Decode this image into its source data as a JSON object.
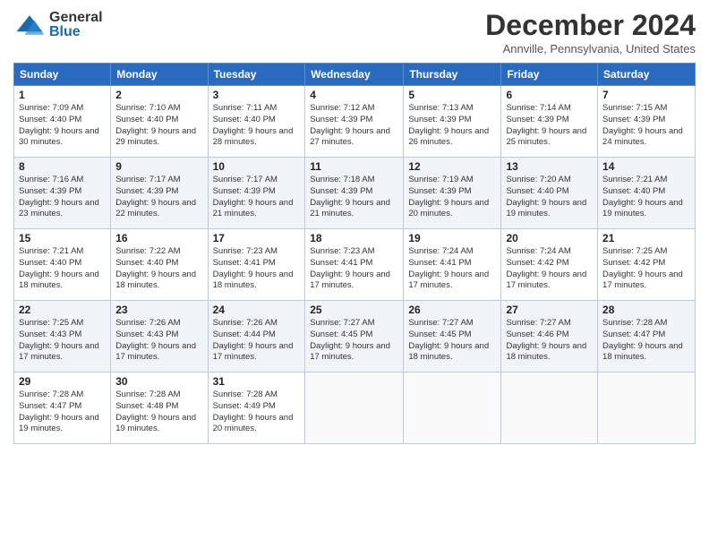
{
  "header": {
    "logo_general": "General",
    "logo_blue": "Blue",
    "month_title": "December 2024",
    "location": "Annville, Pennsylvania, United States"
  },
  "days_of_week": [
    "Sunday",
    "Monday",
    "Tuesday",
    "Wednesday",
    "Thursday",
    "Friday",
    "Saturday"
  ],
  "weeks": [
    [
      {
        "day": "1",
        "sunrise": "Sunrise: 7:09 AM",
        "sunset": "Sunset: 4:40 PM",
        "daylight": "Daylight: 9 hours and 30 minutes."
      },
      {
        "day": "2",
        "sunrise": "Sunrise: 7:10 AM",
        "sunset": "Sunset: 4:40 PM",
        "daylight": "Daylight: 9 hours and 29 minutes."
      },
      {
        "day": "3",
        "sunrise": "Sunrise: 7:11 AM",
        "sunset": "Sunset: 4:40 PM",
        "daylight": "Daylight: 9 hours and 28 minutes."
      },
      {
        "day": "4",
        "sunrise": "Sunrise: 7:12 AM",
        "sunset": "Sunset: 4:39 PM",
        "daylight": "Daylight: 9 hours and 27 minutes."
      },
      {
        "day": "5",
        "sunrise": "Sunrise: 7:13 AM",
        "sunset": "Sunset: 4:39 PM",
        "daylight": "Daylight: 9 hours and 26 minutes."
      },
      {
        "day": "6",
        "sunrise": "Sunrise: 7:14 AM",
        "sunset": "Sunset: 4:39 PM",
        "daylight": "Daylight: 9 hours and 25 minutes."
      },
      {
        "day": "7",
        "sunrise": "Sunrise: 7:15 AM",
        "sunset": "Sunset: 4:39 PM",
        "daylight": "Daylight: 9 hours and 24 minutes."
      }
    ],
    [
      {
        "day": "8",
        "sunrise": "Sunrise: 7:16 AM",
        "sunset": "Sunset: 4:39 PM",
        "daylight": "Daylight: 9 hours and 23 minutes."
      },
      {
        "day": "9",
        "sunrise": "Sunrise: 7:17 AM",
        "sunset": "Sunset: 4:39 PM",
        "daylight": "Daylight: 9 hours and 22 minutes."
      },
      {
        "day": "10",
        "sunrise": "Sunrise: 7:17 AM",
        "sunset": "Sunset: 4:39 PM",
        "daylight": "Daylight: 9 hours and 21 minutes."
      },
      {
        "day": "11",
        "sunrise": "Sunrise: 7:18 AM",
        "sunset": "Sunset: 4:39 PM",
        "daylight": "Daylight: 9 hours and 21 minutes."
      },
      {
        "day": "12",
        "sunrise": "Sunrise: 7:19 AM",
        "sunset": "Sunset: 4:39 PM",
        "daylight": "Daylight: 9 hours and 20 minutes."
      },
      {
        "day": "13",
        "sunrise": "Sunrise: 7:20 AM",
        "sunset": "Sunset: 4:40 PM",
        "daylight": "Daylight: 9 hours and 19 minutes."
      },
      {
        "day": "14",
        "sunrise": "Sunrise: 7:21 AM",
        "sunset": "Sunset: 4:40 PM",
        "daylight": "Daylight: 9 hours and 19 minutes."
      }
    ],
    [
      {
        "day": "15",
        "sunrise": "Sunrise: 7:21 AM",
        "sunset": "Sunset: 4:40 PM",
        "daylight": "Daylight: 9 hours and 18 minutes."
      },
      {
        "day": "16",
        "sunrise": "Sunrise: 7:22 AM",
        "sunset": "Sunset: 4:40 PM",
        "daylight": "Daylight: 9 hours and 18 minutes."
      },
      {
        "day": "17",
        "sunrise": "Sunrise: 7:23 AM",
        "sunset": "Sunset: 4:41 PM",
        "daylight": "Daylight: 9 hours and 18 minutes."
      },
      {
        "day": "18",
        "sunrise": "Sunrise: 7:23 AM",
        "sunset": "Sunset: 4:41 PM",
        "daylight": "Daylight: 9 hours and 17 minutes."
      },
      {
        "day": "19",
        "sunrise": "Sunrise: 7:24 AM",
        "sunset": "Sunset: 4:41 PM",
        "daylight": "Daylight: 9 hours and 17 minutes."
      },
      {
        "day": "20",
        "sunrise": "Sunrise: 7:24 AM",
        "sunset": "Sunset: 4:42 PM",
        "daylight": "Daylight: 9 hours and 17 minutes."
      },
      {
        "day": "21",
        "sunrise": "Sunrise: 7:25 AM",
        "sunset": "Sunset: 4:42 PM",
        "daylight": "Daylight: 9 hours and 17 minutes."
      }
    ],
    [
      {
        "day": "22",
        "sunrise": "Sunrise: 7:25 AM",
        "sunset": "Sunset: 4:43 PM",
        "daylight": "Daylight: 9 hours and 17 minutes."
      },
      {
        "day": "23",
        "sunrise": "Sunrise: 7:26 AM",
        "sunset": "Sunset: 4:43 PM",
        "daylight": "Daylight: 9 hours and 17 minutes."
      },
      {
        "day": "24",
        "sunrise": "Sunrise: 7:26 AM",
        "sunset": "Sunset: 4:44 PM",
        "daylight": "Daylight: 9 hours and 17 minutes."
      },
      {
        "day": "25",
        "sunrise": "Sunrise: 7:27 AM",
        "sunset": "Sunset: 4:45 PM",
        "daylight": "Daylight: 9 hours and 17 minutes."
      },
      {
        "day": "26",
        "sunrise": "Sunrise: 7:27 AM",
        "sunset": "Sunset: 4:45 PM",
        "daylight": "Daylight: 9 hours and 18 minutes."
      },
      {
        "day": "27",
        "sunrise": "Sunrise: 7:27 AM",
        "sunset": "Sunset: 4:46 PM",
        "daylight": "Daylight: 9 hours and 18 minutes."
      },
      {
        "day": "28",
        "sunrise": "Sunrise: 7:28 AM",
        "sunset": "Sunset: 4:47 PM",
        "daylight": "Daylight: 9 hours and 18 minutes."
      }
    ],
    [
      {
        "day": "29",
        "sunrise": "Sunrise: 7:28 AM",
        "sunset": "Sunset: 4:47 PM",
        "daylight": "Daylight: 9 hours and 19 minutes."
      },
      {
        "day": "30",
        "sunrise": "Sunrise: 7:28 AM",
        "sunset": "Sunset: 4:48 PM",
        "daylight": "Daylight: 9 hours and 19 minutes."
      },
      {
        "day": "31",
        "sunrise": "Sunrise: 7:28 AM",
        "sunset": "Sunset: 4:49 PM",
        "daylight": "Daylight: 9 hours and 20 minutes."
      },
      null,
      null,
      null,
      null
    ]
  ]
}
